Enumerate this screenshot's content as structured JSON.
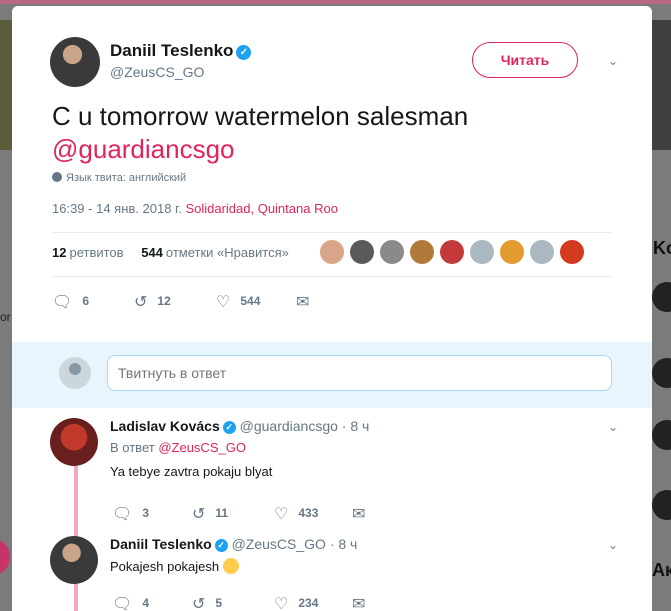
{
  "tweet": {
    "author_name": "Daniil Teslenko",
    "author_handle": "@ZeusCS_GO",
    "follow_label": "Читать",
    "text": "C u tomorrow watermelon salesman",
    "mention": "@guardiancsgo",
    "language_note": "Язык твита: английский",
    "timestamp": "16:39 - 14 янв. 2018 г.",
    "location": "Solidaridad, Quintana Roo",
    "retweets_count": "12",
    "retweets_label": "ретвитов",
    "likes_count": "544",
    "likes_label": "отметки «Нравится»",
    "actions": {
      "replies": "6",
      "retweets": "12",
      "likes": "544"
    }
  },
  "reply_box": {
    "placeholder": "Твитнуть в ответ"
  },
  "replies": [
    {
      "author_name": "Ladislav Kovács",
      "author_handle": "@guardiancsgo",
      "time": "· 8 ч",
      "in_reply_prefix": "В ответ",
      "in_reply_to": "@ZeusCS_GO",
      "text": "Ya tebye zavtra pokaju blyat",
      "actions": {
        "replies": "3",
        "retweets": "11",
        "likes": "433"
      }
    },
    {
      "author_name": "Daniil Teslenko",
      "author_handle": "@ZeusCS_GO",
      "time": "· 8 ч",
      "text": "Pokajesh pokajesh",
      "actions": {
        "replies": "4",
        "retweets": "5",
        "likes": "234"
      }
    }
  ],
  "colors": {
    "accent": "#e0245e",
    "verified": "#1da1f2",
    "thread_line": "#f4a5c6"
  }
}
